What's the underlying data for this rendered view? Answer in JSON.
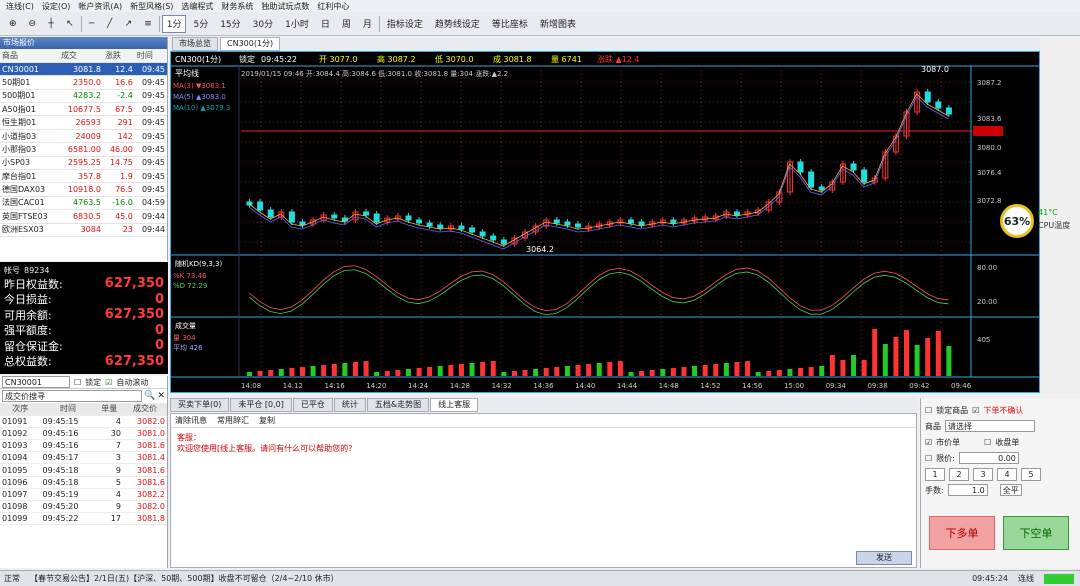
{
  "menu": [
    "连线(C)",
    "设定(O)",
    "帐户资讯(A)",
    "新型风格(S)",
    "选编程式",
    "财务系统",
    "独助试玩点数",
    "红利中心"
  ],
  "toolbar": {
    "periods": [
      "1分",
      "5分",
      "15分",
      "30分",
      "1小时",
      "日",
      "周",
      "月"
    ],
    "buttons": [
      "指标设定",
      "趋势线设定",
      "等比座标",
      "新增图表"
    ]
  },
  "market": {
    "title": "市场报价",
    "headers": [
      "商品",
      "成交",
      "涨跌",
      "时间"
    ],
    "rows": [
      [
        "CN30001",
        "3081.8",
        "12.4",
        "09:45"
      ],
      [
        "50期01",
        "2350.0",
        "16.6",
        "09:45"
      ],
      [
        "500期01",
        "4283.2",
        "-2.4",
        "09:45"
      ],
      [
        "A50指01",
        "10677.5",
        "67.5",
        "09:45"
      ],
      [
        "恒生期01",
        "26593",
        "291",
        "09:45"
      ],
      [
        "小道指03",
        "24009",
        "142",
        "09:45"
      ],
      [
        "小那指03",
        "6581.00",
        "46.00",
        "09:45"
      ],
      [
        "小SP03",
        "2595.25",
        "14.75",
        "09:45"
      ],
      [
        "摩台指01",
        "357.8",
        "1.9",
        "09:45"
      ],
      [
        "德国DAX03",
        "10918.0",
        "76.5",
        "09:45"
      ],
      [
        "法国CAC01",
        "4763.5",
        "-16.0",
        "04:59"
      ],
      [
        "英国FTSE03",
        "6830.5",
        "45.0",
        "09:44"
      ],
      [
        "欧洲ESX03",
        "3084",
        "23",
        "09:44"
      ]
    ]
  },
  "account": {
    "label": "帐号",
    "id": "89234",
    "rows": [
      [
        "昨日权益数:",
        "627,350"
      ],
      [
        "今日损益:",
        "0"
      ],
      [
        "可用余额:",
        "627,350"
      ],
      [
        "强平额度:",
        "0"
      ],
      [
        "留仓保证金:",
        "0"
      ],
      [
        "总权益数:",
        "627,350"
      ]
    ]
  },
  "trades": {
    "symbol": "CN30001",
    "lock": "锁定",
    "auto": "自动滚动",
    "search_placeholder": "成交价搜寻",
    "headers": [
      "次序",
      "时间",
      "单量",
      "成交价"
    ],
    "rows": [
      [
        "01091",
        "09:45:15",
        "4",
        "3082.0"
      ],
      [
        "01092",
        "09:45:16",
        "30",
        "3081.0"
      ],
      [
        "01093",
        "09:45:16",
        "7",
        "3081.6"
      ],
      [
        "01094",
        "09:45:17",
        "3",
        "3081.4"
      ],
      [
        "01095",
        "09:45:18",
        "9",
        "3081.6"
      ],
      [
        "01096",
        "09:45:18",
        "5",
        "3081.6"
      ],
      [
        "01097",
        "09:45:19",
        "4",
        "3082.2"
      ],
      [
        "01098",
        "09:45:20",
        "9",
        "3082.0"
      ],
      [
        "01099",
        "09:45:22",
        "17",
        "3081.8"
      ]
    ]
  },
  "chart": {
    "tabs": [
      "市场总览",
      "CN300(1分)"
    ],
    "header": {
      "name": "CN300(1分)",
      "lock": "锁定",
      "time": "09:45:22",
      "open": "开 3077.0",
      "high": "高 3087.2",
      "low": "低 3070.0",
      "close": "成 3081.8",
      "vol": "量 6741",
      "chg": "涨跌 ▲12.4"
    },
    "info": "2019/01/15 09:46 开:3084.4 高:3084.6 低:3081.0 收:3081.8 量:304 涨跌:▲2.2",
    "ma_title": "平均线",
    "ma": [
      "MA(3) ▼3083.1",
      "MA(5) ▲3083.0",
      "MA(10) ▲3079.3"
    ],
    "kd_title": "随机KD(9,3,3)",
    "kd": [
      "%K 73.46",
      "%D 72.29"
    ],
    "vol_title": "成交量",
    "vol": [
      "量 304",
      "平均 426"
    ],
    "price_labels": [
      "3087.2",
      "3083.6",
      "3081.8",
      "3080.0",
      "3076.4",
      "3072.8"
    ],
    "kd_labels": [
      "80.00",
      "20.00"
    ],
    "vol_label": "405",
    "hi_mark": "3087.0",
    "lo_mark": "3064.2",
    "times": [
      "14:08",
      "14:12",
      "14:16",
      "14:20",
      "14:24",
      "14:28",
      "14:32",
      "14:36",
      "14:40",
      "14:44",
      "14:48",
      "14:52",
      "14:56",
      "15:00",
      "09:34",
      "09:38",
      "09:42",
      "09:46"
    ],
    "cpu": "63%",
    "temp": "41°C",
    "temp_label": "CPU温度"
  },
  "bottom_tabs": [
    "买卖下单(0)",
    "未平仓 [0,0]",
    "已平仓",
    "统计",
    "五档&走势图",
    "线上客服"
  ],
  "chat": {
    "tools": [
      "清除讯息",
      "常用辞汇",
      "复制"
    ],
    "msg1": "客服：",
    "msg2": "欢迎您使用[线上客服。请问有什么可以帮助您的?",
    "send": "发送"
  },
  "order": {
    "lock": "锁定商品",
    "confirm": "下单不确认",
    "product_label": "商品",
    "product": "请选择",
    "market": "市价单",
    "close": "收盘单",
    "limit": "限价:",
    "limit_val": "0.00",
    "qty_label": "手数:",
    "qty": "1.0",
    "all": "全平",
    "keys": [
      "1",
      "2",
      "3",
      "4",
      "5"
    ],
    "buy": "下多单",
    "sell": "下空单"
  },
  "status": {
    "left": "正常",
    "notice": "【春节交易公告】2/1日(五)【沪深、50期、500期】收盘不可留仓（2/4~2/10 休市）",
    "time": "09:45:24",
    "conn": "连线"
  }
}
